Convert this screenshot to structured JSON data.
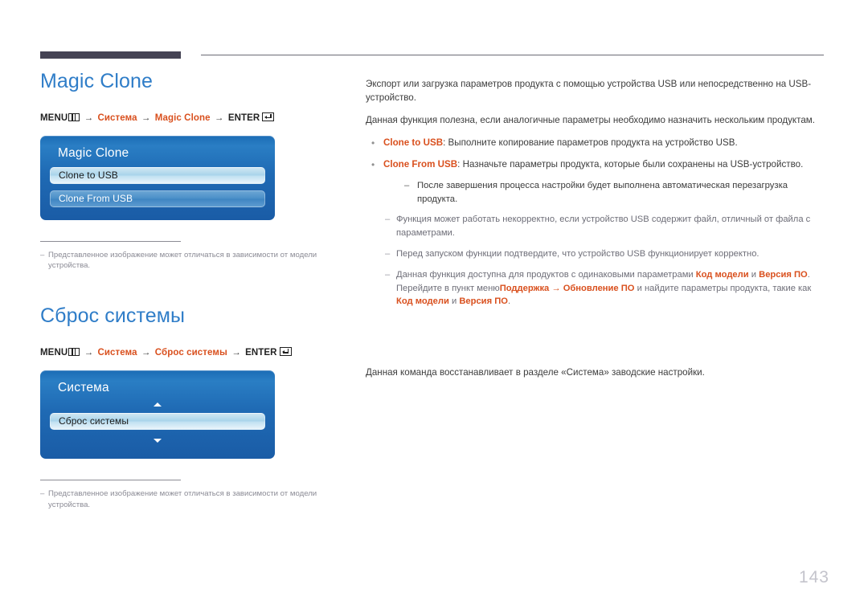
{
  "page": {
    "number": "143"
  },
  "sections": [
    {
      "title": "Magic Clone",
      "menu_path": {
        "menu_label": "MENU",
        "menu_icon": "menu-grid-icon",
        "arrow": "→",
        "step1": "Система",
        "step2": "Magic Clone",
        "enter_label": "ENTER",
        "enter_icon": "enter-return-icon"
      },
      "osd": {
        "title": "Magic Clone",
        "items": [
          {
            "label": "Clone to USB",
            "state": "selected"
          },
          {
            "label": "Clone From USB",
            "state": "plain"
          }
        ],
        "has_scroll_arrows": false
      },
      "note": {
        "dash": "–",
        "text": "Представленное изображение может отличаться в зависимости от модели устройства."
      }
    },
    {
      "title": "Сброс системы",
      "menu_path": {
        "menu_label": "MENU",
        "menu_icon": "menu-grid-icon",
        "arrow": "→",
        "step1": "Система",
        "step2": "Сброс системы",
        "enter_label": "ENTER",
        "enter_icon": "enter-return-icon"
      },
      "osd": {
        "title": "Система",
        "items": [
          {
            "label": "Сброс системы",
            "state": "selected"
          }
        ],
        "has_scroll_arrows": true,
        "scroll_up_icon": "triangle-up-icon",
        "scroll_down_icon": "triangle-down-icon"
      },
      "note": {
        "dash": "–",
        "text": "Представленное изображение может отличаться в зависимости от модели устройства."
      }
    }
  ],
  "magic_clone_body": {
    "para1": "Экспорт или загрузка параметров продукта с помощью устройства USB или непосредственно на USB-устройство.",
    "para2": "Данная функция полезна, если аналогичные параметры необходимо назначить нескольким продуктам.",
    "bullet_marker": "•",
    "bullet1_label": "Clone to USB",
    "bullet1_text": ": Выполните копирование параметров продукта на устройство USB.",
    "bullet2_label": "Clone From USB",
    "bullet2_text": ": Назначьте параметры продукта, которые были сохранены на USB-устройство.",
    "subdash_marker": "–",
    "subdash_text": "После завершения процесса настройки будет выполнена автоматическая перезагрузка продукта.",
    "note_marker": "–",
    "note1": "Функция может работать некорректно, если устройство USB содержит файл, отличный от файла с параметрами.",
    "note2": "Перед запуском функции подтвердите, что устройство USB функционирует корректно.",
    "note3_part1": "Данная функция доступна для продуктов с одинаковыми параметрами ",
    "note3_b1": "Код модели",
    "note3_part2": " и ",
    "note3_b2": "Версия ПО",
    "note3_part3": ". Перейдите в пункт меню",
    "note3_b3": "Поддержка",
    "note3_arrow": " → ",
    "note3_b4": "Обновление ПО",
    "note3_part4": " и найдите параметры продукта, такие как ",
    "note3_b5": "Код модели",
    "note3_part5": " и ",
    "note3_b6": "Версия ПО",
    "note3_part6": "."
  },
  "system_reset_body": {
    "para1": "Данная команда восстанавливает в разделе «Система» заводские настройки."
  },
  "colors": {
    "heading": "#2f7dc8",
    "accent": "#d9501e",
    "rule_dark": "#454354",
    "panel_blue": "#1f6ab4",
    "page_number": "#c4c4cc"
  }
}
